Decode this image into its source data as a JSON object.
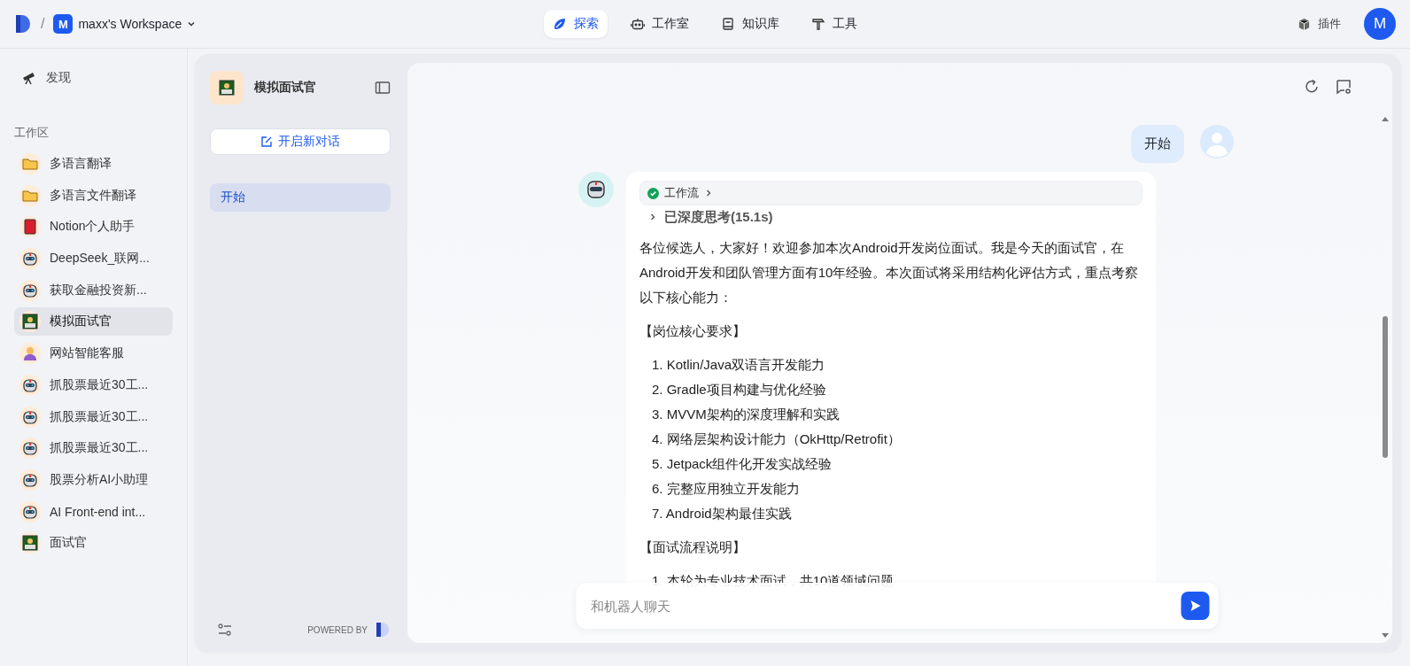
{
  "topbar": {
    "separator": "/",
    "workspace_initial": "M",
    "workspace_name": "maxx's Workspace",
    "nav": [
      {
        "label": "探索",
        "kind": "explore",
        "selected": true
      },
      {
        "label": "工作室",
        "kind": "studio",
        "selected": false
      },
      {
        "label": "知识库",
        "kind": "knowledge",
        "selected": false
      },
      {
        "label": "工具",
        "kind": "tools",
        "selected": false
      }
    ],
    "plugins_label": "插件",
    "avatar_initial": "M"
  },
  "sidebar": {
    "discover": "发现",
    "section_title": "工作区",
    "items": [
      {
        "label": "多语言翻译",
        "kind": "folder",
        "selected": false
      },
      {
        "label": "多语言文件翻译",
        "kind": "folder",
        "selected": false
      },
      {
        "label": "Notion个人助手",
        "kind": "book",
        "selected": false
      },
      {
        "label": "DeepSeek_联网...",
        "kind": "robot",
        "selected": false
      },
      {
        "label": "获取金融投资新...",
        "kind": "robot",
        "selected": false
      },
      {
        "label": "模拟面试官",
        "kind": "coder",
        "selected": true
      },
      {
        "label": "网站智能客服",
        "kind": "agent",
        "selected": false
      },
      {
        "label": "抓股票最近30工...",
        "kind": "robot",
        "selected": false
      },
      {
        "label": "抓股票最近30工...",
        "kind": "robot",
        "selected": false
      },
      {
        "label": "抓股票最近30工...",
        "kind": "robot",
        "selected": false
      },
      {
        "label": "股票分析AI小助理",
        "kind": "robot",
        "selected": false
      },
      {
        "label": "AI Front-end int...",
        "kind": "robot",
        "selected": false
      },
      {
        "label": "面试官",
        "kind": "coder",
        "selected": false
      }
    ]
  },
  "bot_panel": {
    "name": "模拟面试官",
    "new_chat": "开启新对话",
    "conversations": [
      {
        "label": "开始",
        "selected": true
      }
    ],
    "powered_by": "POWERED BY"
  },
  "chat": {
    "messages": [
      {
        "kind": "user",
        "text": "开始"
      },
      {
        "kind": "bot",
        "workflow": "工作流",
        "thinking": "已深度思考(15.1s)",
        "blocks": [
          {
            "kind": "paragraph",
            "text": "各位候选人，大家好！欢迎参加本次Android开发岗位面试。我是今天的面试官，在Android开发和团队管理方面有10年经验。本次面试将采用结构化评估方式，重点考察以下核心能力："
          },
          {
            "kind": "paragraph",
            "text": "【岗位核心要求】"
          },
          {
            "kind": "list",
            "items": [
              "1. Kotlin/Java双语言开发能力",
              "2. Gradle项目构建与优化经验",
              "3. MVVM架构的深度理解和实践",
              "4. 网络层架构设计能力（OkHttp/Retrofit）",
              "5. Jetpack组件化开发实战经验",
              "6. 完整应用独立开发能力",
              "7. Android架构最佳实践"
            ]
          },
          {
            "kind": "paragraph",
            "text": "【面试流程说明】"
          },
          {
            "kind": "list",
            "items": [
              "1. 本轮为专业技术面试，共10道领域问题"
            ]
          }
        ]
      }
    ],
    "input": {
      "placeholder": "和机器人聊天"
    }
  }
}
